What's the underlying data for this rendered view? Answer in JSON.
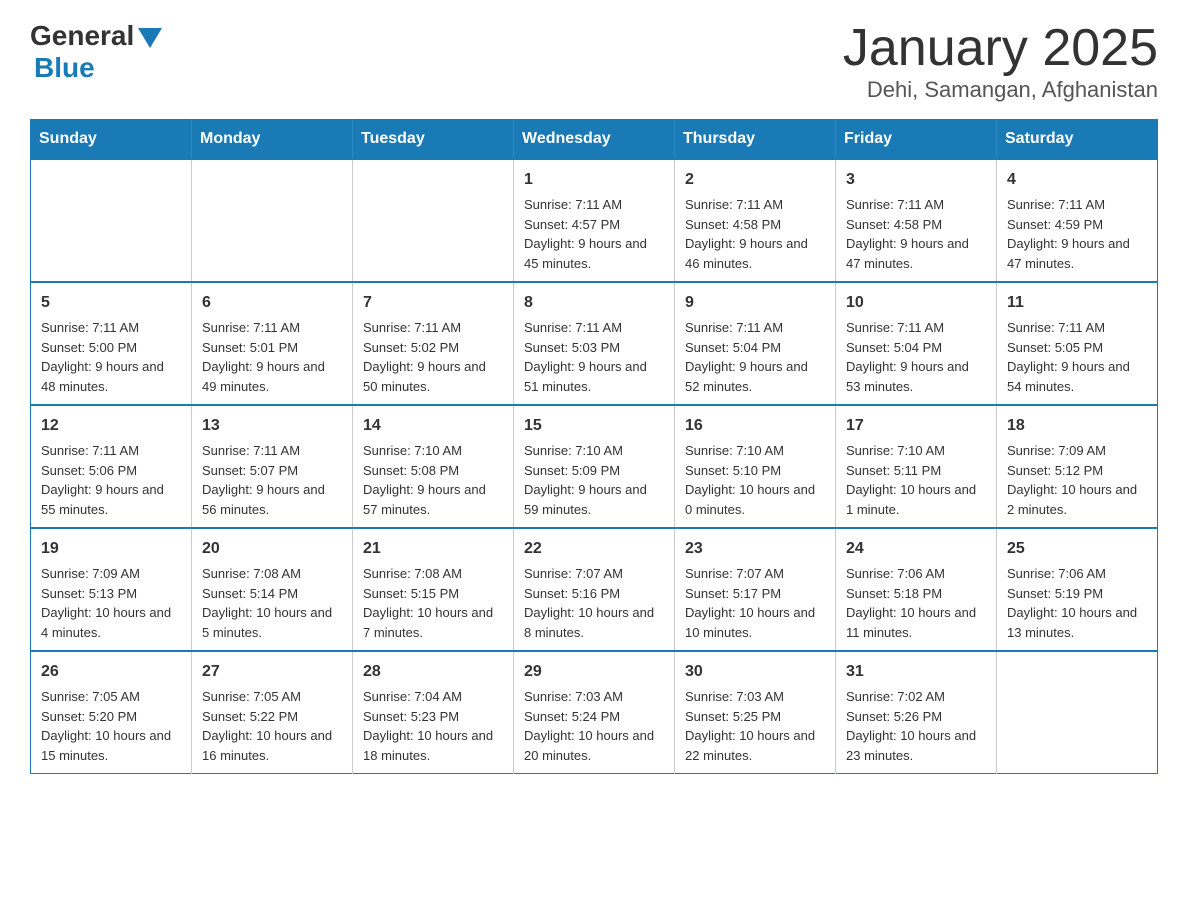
{
  "header": {
    "logo_general": "General",
    "logo_blue": "Blue",
    "title": "January 2025",
    "subtitle": "Dehi, Samangan, Afghanistan"
  },
  "days_of_week": [
    "Sunday",
    "Monday",
    "Tuesday",
    "Wednesday",
    "Thursday",
    "Friday",
    "Saturday"
  ],
  "weeks": [
    [
      {
        "day": "",
        "info": ""
      },
      {
        "day": "",
        "info": ""
      },
      {
        "day": "",
        "info": ""
      },
      {
        "day": "1",
        "info": "Sunrise: 7:11 AM\nSunset: 4:57 PM\nDaylight: 9 hours and 45 minutes."
      },
      {
        "day": "2",
        "info": "Sunrise: 7:11 AM\nSunset: 4:58 PM\nDaylight: 9 hours and 46 minutes."
      },
      {
        "day": "3",
        "info": "Sunrise: 7:11 AM\nSunset: 4:58 PM\nDaylight: 9 hours and 47 minutes."
      },
      {
        "day": "4",
        "info": "Sunrise: 7:11 AM\nSunset: 4:59 PM\nDaylight: 9 hours and 47 minutes."
      }
    ],
    [
      {
        "day": "5",
        "info": "Sunrise: 7:11 AM\nSunset: 5:00 PM\nDaylight: 9 hours and 48 minutes."
      },
      {
        "day": "6",
        "info": "Sunrise: 7:11 AM\nSunset: 5:01 PM\nDaylight: 9 hours and 49 minutes."
      },
      {
        "day": "7",
        "info": "Sunrise: 7:11 AM\nSunset: 5:02 PM\nDaylight: 9 hours and 50 minutes."
      },
      {
        "day": "8",
        "info": "Sunrise: 7:11 AM\nSunset: 5:03 PM\nDaylight: 9 hours and 51 minutes."
      },
      {
        "day": "9",
        "info": "Sunrise: 7:11 AM\nSunset: 5:04 PM\nDaylight: 9 hours and 52 minutes."
      },
      {
        "day": "10",
        "info": "Sunrise: 7:11 AM\nSunset: 5:04 PM\nDaylight: 9 hours and 53 minutes."
      },
      {
        "day": "11",
        "info": "Sunrise: 7:11 AM\nSunset: 5:05 PM\nDaylight: 9 hours and 54 minutes."
      }
    ],
    [
      {
        "day": "12",
        "info": "Sunrise: 7:11 AM\nSunset: 5:06 PM\nDaylight: 9 hours and 55 minutes."
      },
      {
        "day": "13",
        "info": "Sunrise: 7:11 AM\nSunset: 5:07 PM\nDaylight: 9 hours and 56 minutes."
      },
      {
        "day": "14",
        "info": "Sunrise: 7:10 AM\nSunset: 5:08 PM\nDaylight: 9 hours and 57 minutes."
      },
      {
        "day": "15",
        "info": "Sunrise: 7:10 AM\nSunset: 5:09 PM\nDaylight: 9 hours and 59 minutes."
      },
      {
        "day": "16",
        "info": "Sunrise: 7:10 AM\nSunset: 5:10 PM\nDaylight: 10 hours and 0 minutes."
      },
      {
        "day": "17",
        "info": "Sunrise: 7:10 AM\nSunset: 5:11 PM\nDaylight: 10 hours and 1 minute."
      },
      {
        "day": "18",
        "info": "Sunrise: 7:09 AM\nSunset: 5:12 PM\nDaylight: 10 hours and 2 minutes."
      }
    ],
    [
      {
        "day": "19",
        "info": "Sunrise: 7:09 AM\nSunset: 5:13 PM\nDaylight: 10 hours and 4 minutes."
      },
      {
        "day": "20",
        "info": "Sunrise: 7:08 AM\nSunset: 5:14 PM\nDaylight: 10 hours and 5 minutes."
      },
      {
        "day": "21",
        "info": "Sunrise: 7:08 AM\nSunset: 5:15 PM\nDaylight: 10 hours and 7 minutes."
      },
      {
        "day": "22",
        "info": "Sunrise: 7:07 AM\nSunset: 5:16 PM\nDaylight: 10 hours and 8 minutes."
      },
      {
        "day": "23",
        "info": "Sunrise: 7:07 AM\nSunset: 5:17 PM\nDaylight: 10 hours and 10 minutes."
      },
      {
        "day": "24",
        "info": "Sunrise: 7:06 AM\nSunset: 5:18 PM\nDaylight: 10 hours and 11 minutes."
      },
      {
        "day": "25",
        "info": "Sunrise: 7:06 AM\nSunset: 5:19 PM\nDaylight: 10 hours and 13 minutes."
      }
    ],
    [
      {
        "day": "26",
        "info": "Sunrise: 7:05 AM\nSunset: 5:20 PM\nDaylight: 10 hours and 15 minutes."
      },
      {
        "day": "27",
        "info": "Sunrise: 7:05 AM\nSunset: 5:22 PM\nDaylight: 10 hours and 16 minutes."
      },
      {
        "day": "28",
        "info": "Sunrise: 7:04 AM\nSunset: 5:23 PM\nDaylight: 10 hours and 18 minutes."
      },
      {
        "day": "29",
        "info": "Sunrise: 7:03 AM\nSunset: 5:24 PM\nDaylight: 10 hours and 20 minutes."
      },
      {
        "day": "30",
        "info": "Sunrise: 7:03 AM\nSunset: 5:25 PM\nDaylight: 10 hours and 22 minutes."
      },
      {
        "day": "31",
        "info": "Sunrise: 7:02 AM\nSunset: 5:26 PM\nDaylight: 10 hours and 23 minutes."
      },
      {
        "day": "",
        "info": ""
      }
    ]
  ]
}
